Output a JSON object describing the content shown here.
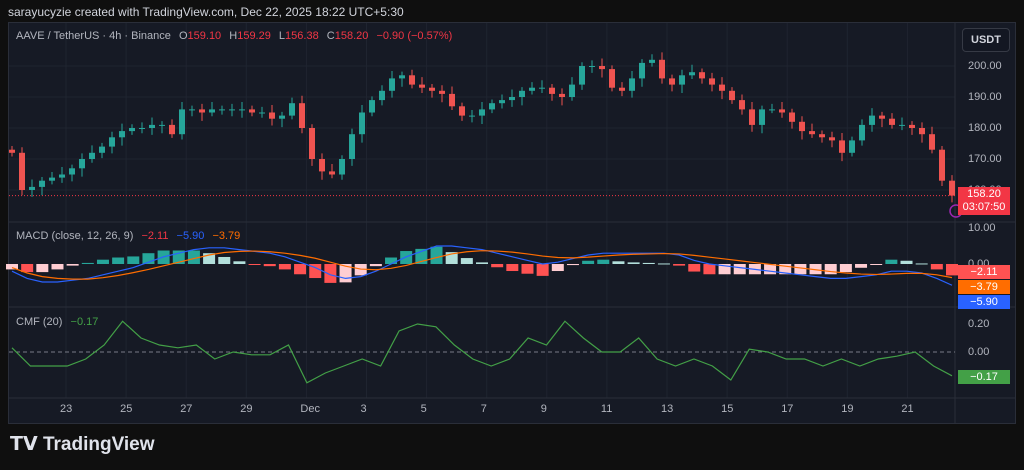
{
  "header": {
    "attribution": "sarayucyzie created with TradingView.com, Dec 22, 2025 18:22 UTC+5:30"
  },
  "symbol": {
    "name": "AAVE / TetherUS · 4h · Binance",
    "o_label": "O",
    "o": "159.10",
    "h_label": "H",
    "h": "159.29",
    "l_label": "L",
    "l": "156.38",
    "c_label": "C",
    "c": "158.20",
    "change": "−0.90 (−0.57%)"
  },
  "currency": "USDT",
  "price_axis": [
    "200.00",
    "190.00",
    "180.00",
    "170.00",
    "160.00"
  ],
  "last_price": {
    "value": "158.20",
    "countdown": "03:07:50"
  },
  "macd": {
    "title": "MACD (close, 12, 26, 9)",
    "hist": "−2.11",
    "macd": "−5.90",
    "signal": "−3.79",
    "axis": [
      "10.00",
      "0.00"
    ]
  },
  "cmf": {
    "title": "CMF (20)",
    "value": "−0.17",
    "axis": [
      "0.20",
      "0.00"
    ]
  },
  "time_axis": [
    "23",
    "25",
    "27",
    "29",
    "Dec",
    "3",
    "5",
    "7",
    "9",
    "11",
    "13",
    "15",
    "17",
    "19",
    "21"
  ],
  "footer": {
    "logo": "TradingView"
  },
  "colors": {
    "up": "#26a69a",
    "down": "#ef5350",
    "macd": "#2962ff",
    "signal": "#ff6d00",
    "cmf": "#43a047"
  },
  "chart_data": {
    "type": "candlestick",
    "interval": "8h approx closes",
    "closes": [
      172,
      160,
      161,
      163,
      164,
      165,
      167,
      170,
      172,
      174,
      177,
      179,
      180,
      180,
      181,
      181,
      178,
      186,
      186,
      185,
      186,
      186,
      186,
      186,
      185,
      185,
      183,
      184,
      188,
      180,
      170,
      166,
      165,
      170,
      178,
      185,
      189,
      192,
      196,
      197,
      194,
      193,
      192,
      191,
      187,
      184,
      184,
      186,
      188,
      189,
      190,
      192,
      193,
      193,
      191,
      190,
      194,
      200,
      200,
      199,
      193,
      192,
      196,
      201,
      202,
      196,
      194,
      197,
      198,
      196,
      194,
      192,
      189,
      186,
      181,
      186,
      186,
      185,
      182,
      179,
      178,
      177,
      176,
      172,
      176,
      181,
      184,
      183,
      181,
      181,
      180,
      178,
      173,
      163,
      158.2
    ],
    "ylim": [
      155,
      208
    ],
    "macd_line": [
      -2,
      -4,
      -5,
      -5,
      -4.5,
      -4,
      -3,
      -2,
      -1,
      0.5,
      2,
      3,
      4,
      4.5,
      4.5,
      4,
      3.5,
      3,
      2,
      0.5,
      -1,
      -3,
      -4,
      -3.5,
      -2,
      0,
      2,
      3.5,
      5,
      5,
      4.5,
      4,
      3,
      2,
      1,
      0,
      0.5,
      1.5,
      2.5,
      3,
      3,
      3,
      3,
      3,
      2.5,
      1,
      0,
      -0.5,
      -1,
      -1.5,
      -2,
      -2.5,
      -3,
      -3.5,
      -4,
      -4,
      -3.5,
      -3,
      -2,
      -2,
      -2.5,
      -4,
      -5.9
    ],
    "signal_line": [
      -1,
      -2.5,
      -3.5,
      -4,
      -4.2,
      -4.2,
      -3.8,
      -3.2,
      -2.4,
      -1.5,
      -0.5,
      0.5,
      1.5,
      2.5,
      3.2,
      3.5,
      3.6,
      3.4,
      3,
      2.4,
      1.6,
      0.5,
      -0.6,
      -1.4,
      -1.6,
      -1.2,
      -0.4,
      0.7,
      1.8,
      2.8,
      3.4,
      3.7,
      3.6,
      3.3,
      2.8,
      2.2,
      1.8,
      1.7,
      1.9,
      2.2,
      2.5,
      2.7,
      2.8,
      2.9,
      2.8,
      2.4,
      1.9,
      1.4,
      0.9,
      0.4,
      -0.1,
      -0.6,
      -1.1,
      -1.6,
      -2.1,
      -2.5,
      -2.8,
      -2.9,
      -2.8,
      -2.6,
      -2.6,
      -3,
      -3.79
    ],
    "macd_ylim": [
      -12,
      10
    ],
    "cmf_line": [
      0.03,
      -0.1,
      -0.1,
      -0.1,
      -0.05,
      0.05,
      0.22,
      0.1,
      0.05,
      0.03,
      0.05,
      -0.05,
      0,
      -0.02,
      -0.02,
      0.05,
      -0.22,
      -0.15,
      -0.1,
      -0.05,
      -0.1,
      0.15,
      0.2,
      0.18,
      0.05,
      -0.05,
      -0.1,
      -0.05,
      0.1,
      0.05,
      0.22,
      0.1,
      0,
      0,
      0.1,
      -0.05,
      -0.1,
      -0.05,
      -0.1,
      -0.2,
      0.02,
      0,
      -0.05,
      -0.05,
      -0.1,
      -0.05,
      -0.1,
      -0.05,
      -0.03,
      0,
      -0.1,
      -0.17
    ],
    "cmf_ylim": [
      -0.25,
      0.3
    ]
  }
}
